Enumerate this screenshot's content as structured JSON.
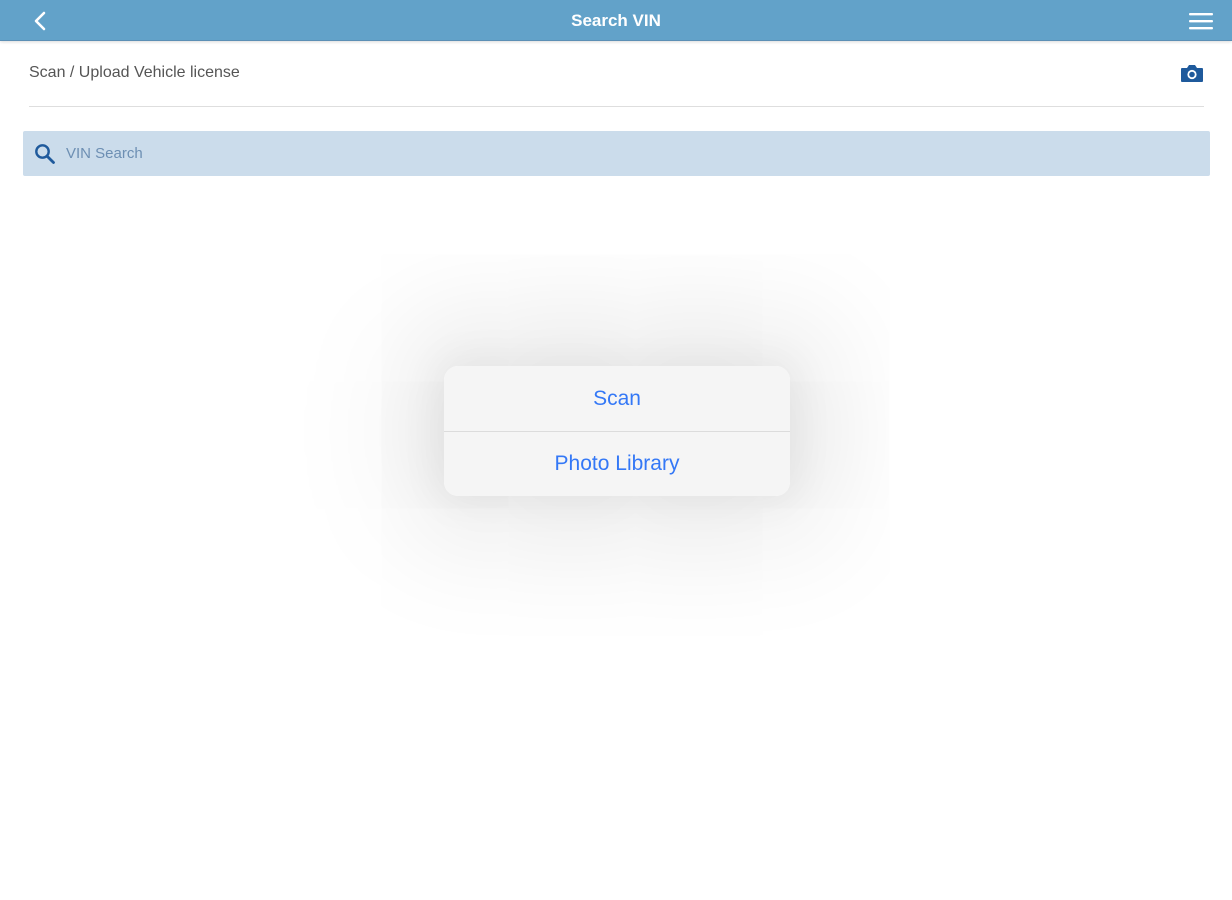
{
  "colors": {
    "navbar_bg": "#62a2c9",
    "search_bg": "#cbdceb",
    "icon_blue": "#1f5a9c",
    "action_blue": "#3478f6",
    "popover_bg": "#f5f5f5"
  },
  "navbar": {
    "title": "Search VIN",
    "back_icon": "chevron-left-icon",
    "menu_icon": "hamburger-menu-icon"
  },
  "upload": {
    "label": "Scan / Upload Vehicle license",
    "icon": "camera-icon"
  },
  "search": {
    "placeholder": "VIN Search",
    "value": "",
    "icon": "search-icon"
  },
  "action_sheet": {
    "items": [
      {
        "label": "Scan"
      },
      {
        "label": "Photo Library"
      }
    ]
  }
}
